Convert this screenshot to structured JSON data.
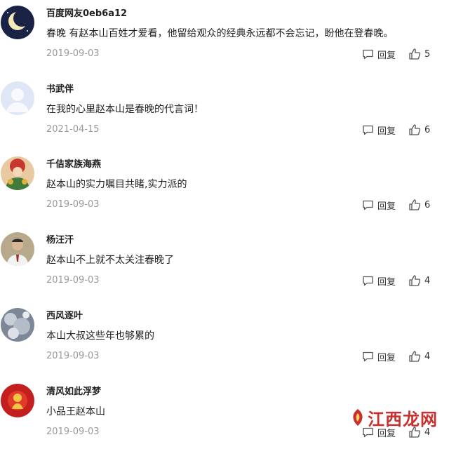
{
  "comments": [
    {
      "user": "百度网友0eb6a12",
      "text": "春晚 有赵本山百姓才爱看，他留给观众的经典永远都不会忘记，盼他在登春晚。",
      "date": "2019-09-03",
      "reply_label": "回复",
      "likes": "5",
      "avatar_icon": "moon-night-avatar"
    },
    {
      "user": "书武伴",
      "text": "在我的心里赵本山是春晚的代言词！",
      "date": "2021-04-15",
      "reply_label": "回复",
      "likes": "6",
      "avatar_icon": "default-user-avatar"
    },
    {
      "user": "千佶家族海燕",
      "text": "赵本山的实力嘱目共睹,实力派的",
      "date": "2019-09-03",
      "reply_label": "回复",
      "likes": "6",
      "avatar_icon": "opera-avatar"
    },
    {
      "user": "杨汪汗",
      "text": "赵本山不上就不太关注春晚了",
      "date": "2019-09-03",
      "reply_label": "回复",
      "likes": "4",
      "avatar_icon": "man-photo-avatar"
    },
    {
      "user": "西风逐叶",
      "text": "本山大叔这些年也够累的",
      "date": "2019-09-03",
      "reply_label": "回复",
      "likes": "4",
      "avatar_icon": "snow-avatar"
    },
    {
      "user": "清风如此浮梦",
      "text": "小品王赵本山",
      "date": "2019-09-03",
      "reply_label": "回复",
      "likes": "4",
      "avatar_icon": "red-festival-avatar"
    }
  ],
  "watermark": {
    "text": "江西龙网"
  },
  "colors": {
    "date": "#999999",
    "text": "#222222",
    "icon": "#555555",
    "watermark": "#c8302e"
  }
}
